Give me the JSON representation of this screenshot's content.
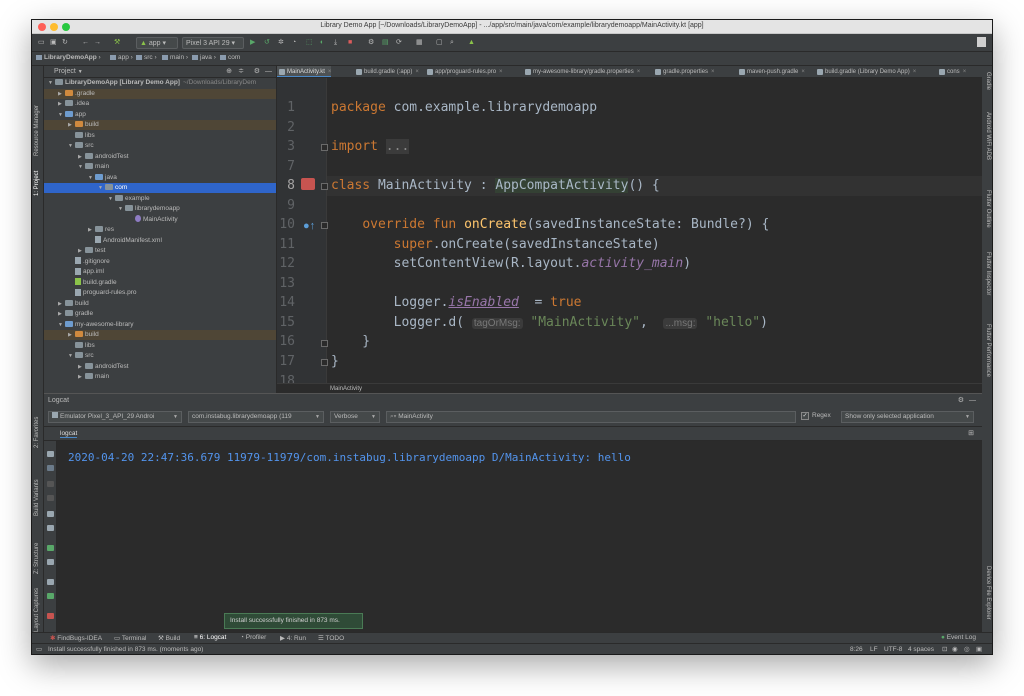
{
  "window": {
    "title": "Library Demo App [~/Downloads/LibraryDemoApp] - .../app/src/main/java/com/example/librarydemoapp/MainActivity.kt [app]"
  },
  "toolbar": {
    "module": "app",
    "device": "Pixel 3 API 29"
  },
  "navbar": {
    "crumbs": [
      "LibraryDemoApp",
      "app",
      "src",
      "main",
      "java",
      "com"
    ]
  },
  "left_tools": {
    "resource_manager": "Resource Manager",
    "project": "1: Project",
    "favorites": "2: Favorites",
    "build_variants": "Build Variants",
    "structure": "Z: Structure",
    "layout_captures": "Layout Captures"
  },
  "right_tools": {
    "gradle": "Gradle",
    "wifi_adb": "Android WiFi ADB",
    "flutter_outline": "Flutter Outline",
    "flutter_inspector": "Flutter Inspector",
    "flutter_performance": "Flutter Performance",
    "device_file_explorer": "Device File Explorer"
  },
  "project": {
    "header": "Project",
    "tree": [
      {
        "label": "LibraryDemoApp [Library Demo App]",
        "extra": "~/Downloads/LibraryDem",
        "indent": 0,
        "arrow": "▼",
        "icon": "folder"
      },
      {
        "label": ".gradle",
        "indent": 1,
        "arrow": "▶",
        "icon": "folder-orange",
        "hl": true
      },
      {
        "label": ".idea",
        "indent": 1,
        "arrow": "▶",
        "icon": "folder"
      },
      {
        "label": "app",
        "indent": 1,
        "arrow": "▼",
        "icon": "folder-blue"
      },
      {
        "label": "build",
        "indent": 2,
        "arrow": "▶",
        "icon": "folder-orange",
        "hl": true
      },
      {
        "label": "libs",
        "indent": 2,
        "arrow": "",
        "icon": "folder"
      },
      {
        "label": "src",
        "indent": 2,
        "arrow": "▼",
        "icon": "folder"
      },
      {
        "label": "androidTest",
        "indent": 3,
        "arrow": "▶",
        "icon": "folder"
      },
      {
        "label": "main",
        "indent": 3,
        "arrow": "▼",
        "icon": "folder"
      },
      {
        "label": "java",
        "indent": 4,
        "arrow": "▼",
        "icon": "folder-blue"
      },
      {
        "label": "com",
        "indent": 5,
        "arrow": "▼",
        "icon": "folder",
        "sel": true
      },
      {
        "label": "example",
        "indent": 6,
        "arrow": "▼",
        "icon": "folder"
      },
      {
        "label": "librarydemoapp",
        "indent": 7,
        "arrow": "▼",
        "icon": "folder"
      },
      {
        "label": "MainActivity",
        "indent": 8,
        "arrow": "",
        "icon": "kt"
      },
      {
        "label": "res",
        "indent": 4,
        "arrow": "▶",
        "icon": "folder"
      },
      {
        "label": "AndroidManifest.xml",
        "indent": 4,
        "arrow": "",
        "icon": "file"
      },
      {
        "label": "test",
        "indent": 3,
        "arrow": "▶",
        "icon": "folder"
      },
      {
        "label": ".gitignore",
        "indent": 2,
        "arrow": "",
        "icon": "file"
      },
      {
        "label": "app.iml",
        "indent": 2,
        "arrow": "",
        "icon": "file"
      },
      {
        "label": "build.gradle",
        "indent": 2,
        "arrow": "",
        "icon": "file-green"
      },
      {
        "label": "proguard-rules.pro",
        "indent": 2,
        "arrow": "",
        "icon": "file"
      },
      {
        "label": "build",
        "indent": 1,
        "arrow": "▶",
        "icon": "folder"
      },
      {
        "label": "gradle",
        "indent": 1,
        "arrow": "▶",
        "icon": "folder"
      },
      {
        "label": "my-awesome-library",
        "indent": 1,
        "arrow": "▼",
        "icon": "folder-blue"
      },
      {
        "label": "build",
        "indent": 2,
        "arrow": "▶",
        "icon": "folder-orange",
        "hl": true
      },
      {
        "label": "libs",
        "indent": 2,
        "arrow": "",
        "icon": "folder"
      },
      {
        "label": "src",
        "indent": 2,
        "arrow": "▼",
        "icon": "folder"
      },
      {
        "label": "androidTest",
        "indent": 3,
        "arrow": "▶",
        "icon": "folder"
      },
      {
        "label": "main",
        "indent": 3,
        "arrow": "▶",
        "icon": "folder"
      }
    ]
  },
  "tabs": [
    {
      "label": "MainActivity.kt",
      "active": true
    },
    {
      "label": "build.gradle (:app)"
    },
    {
      "label": "app/proguard-rules.pro"
    },
    {
      "label": "my-awesome-library/gradle.properties"
    },
    {
      "label": "gradle.properties"
    },
    {
      "label": "maven-push.gradle"
    },
    {
      "label": "build.gradle (Library Demo App)"
    },
    {
      "label": "cons"
    }
  ],
  "editor": {
    "line_numbers": [
      "1",
      "2",
      "3",
      "7",
      "8",
      "9",
      "10",
      "11",
      "12",
      "13",
      "14",
      "15",
      "16",
      "17",
      "18"
    ],
    "current_line": "8",
    "breadcrumb": "MainActivity"
  },
  "logcat": {
    "title": "Logcat",
    "device": "Emulator Pixel_3_API_29  Androi",
    "process": "com.instabug.librarydemoapp (119",
    "level": "Verbose",
    "search": "MainActivity",
    "regex_label": "Regex",
    "filter_mode": "Show only selected application",
    "tab": "logcat",
    "line": "2020-04-20 22:47:36.679 11979-11979/com.instabug.librarydemoapp D/MainActivity: hello"
  },
  "toast": "Install successfully finished in 873 ms.",
  "bottom_tabs": [
    "FindBugs-IDEA",
    "Terminal",
    "Build",
    "6: Logcat",
    "Profiler",
    "4: Run",
    "TODO"
  ],
  "event_log": "Event Log",
  "status": {
    "message": "Install successfully finished in 873 ms. (moments ago)",
    "position": "8:26",
    "line_sep": "LF",
    "encoding": "UTF-8",
    "indent": "4 spaces"
  }
}
